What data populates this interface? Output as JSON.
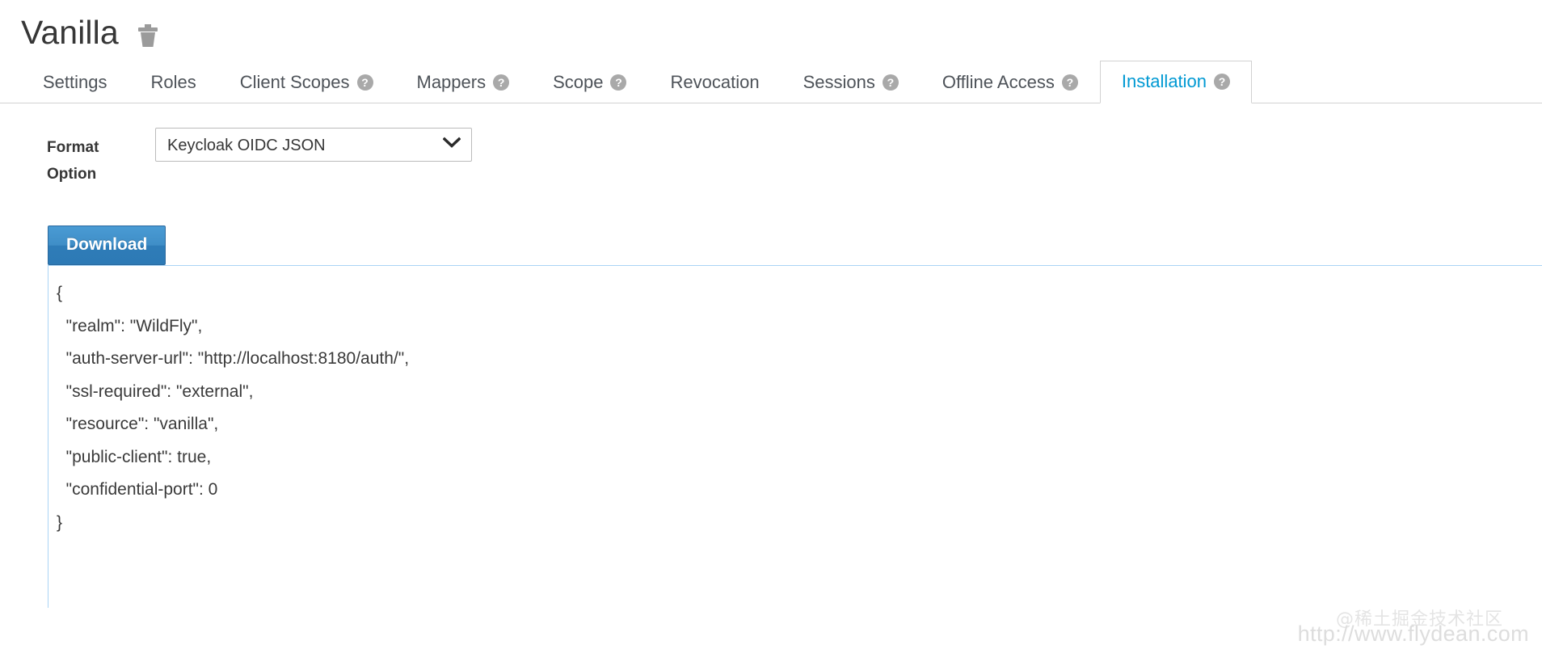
{
  "header": {
    "title": "Vanilla",
    "delete_icon": "trash-icon"
  },
  "tabs": [
    {
      "label": "Settings",
      "help": false,
      "active": false
    },
    {
      "label": "Roles",
      "help": false,
      "active": false
    },
    {
      "label": "Client Scopes",
      "help": true,
      "active": false
    },
    {
      "label": "Mappers",
      "help": true,
      "active": false
    },
    {
      "label": "Scope",
      "help": true,
      "active": false
    },
    {
      "label": "Revocation",
      "help": false,
      "active": false
    },
    {
      "label": "Sessions",
      "help": true,
      "active": false
    },
    {
      "label": "Offline Access",
      "help": true,
      "active": false
    },
    {
      "label": "Installation",
      "help": true,
      "active": true
    }
  ],
  "form": {
    "format_label_line1": "Format",
    "format_label_line2": "Option",
    "format_selected": "Keycloak OIDC JSON",
    "format_options": [
      "Keycloak OIDC JSON"
    ],
    "chevron_icon": "chevron-down-icon"
  },
  "actions": {
    "download_label": "Download"
  },
  "config": {
    "json_text": "{\n  \"realm\": \"WildFly\",\n  \"auth-server-url\": \"http://localhost:8180/auth/\",\n  \"ssl-required\": \"external\",\n  \"resource\": \"vanilla\",\n  \"public-client\": true,\n  \"confidential-port\": 0\n}"
  },
  "watermark": {
    "url": "http://www.flydean.com",
    "community": "@稀土掘金技术社区"
  },
  "colors": {
    "accent_blue": "#0099d3",
    "button_blue": "#3f8ec7",
    "textarea_border": "#aad4f5",
    "tab_text": "#4d5258",
    "help_icon_gray": "#a9a9a9"
  },
  "help_glyph": "?"
}
